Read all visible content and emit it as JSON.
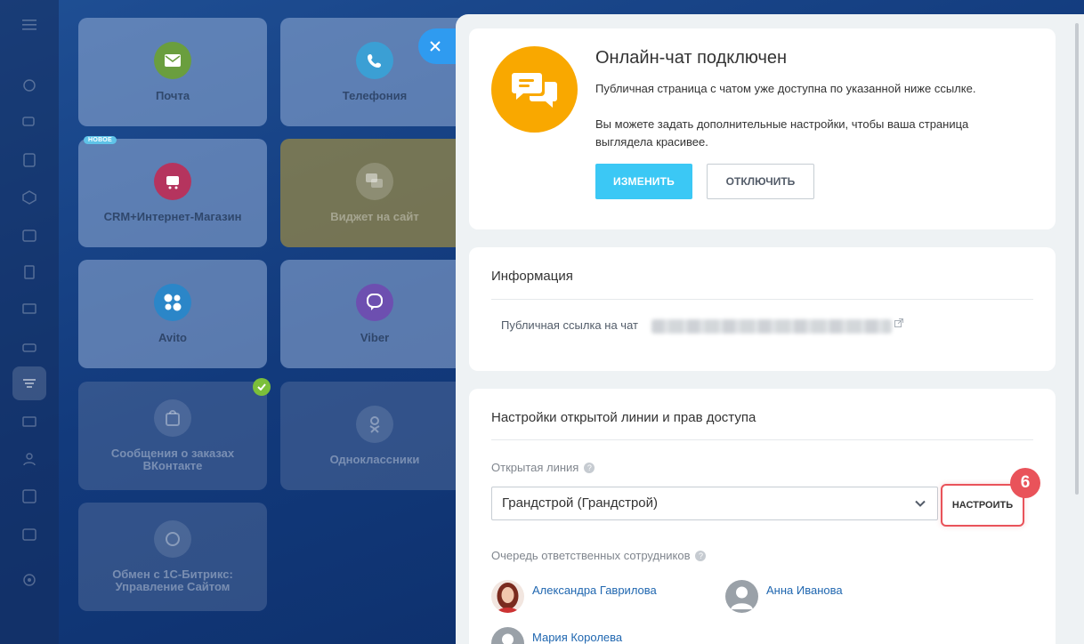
{
  "nav": {
    "icons": [
      "menu-icon",
      "feed-icon",
      "chat-icon",
      "tasks-icon",
      "crm-icon",
      "calendar-icon",
      "docs-icon",
      "sites-icon",
      "store-icon",
      "contact-center-icon",
      "mail-icon",
      "users-icon",
      "checklist-icon",
      "planner-icon",
      "settings-icon"
    ]
  },
  "tiles": [
    {
      "label": "Почта",
      "icon": "mail-icon"
    },
    {
      "label": "Телефония",
      "icon": "phone-icon"
    },
    {
      "label": "CRM+Интернет-Магазин",
      "icon": "store-icon",
      "badge": "НОВОЕ"
    },
    {
      "label": "Виджет на сайт",
      "icon": "chat-icon"
    },
    {
      "label": "Avito",
      "icon": "avito-icon"
    },
    {
      "label": "Viber",
      "icon": "viber-icon"
    },
    {
      "label": "Сообщения о заказах ВКонтакте",
      "icon": "vk-icon"
    },
    {
      "label": "Одноклассники",
      "icon": "ok-icon"
    },
    {
      "label": "Обмен с 1С-Битрикс: Управление Сайтом",
      "icon": "bitrix-icon"
    }
  ],
  "status_card": {
    "title": "Онлайн-чат подключен",
    "text1": "Публичная страница с чатом уже доступна по указанной ниже ссылке.",
    "text2": "Вы можете задать дополнительные настройки, чтобы ваша страница выглядела красивее.",
    "change_button": "ИЗМЕНИТЬ",
    "disable_button": "ОТКЛЮЧИТЬ"
  },
  "info_card": {
    "title": "Информация",
    "link_label": "Публичная ссылка на чат"
  },
  "settings_card": {
    "title": "Настройки открытой линии и прав доступа",
    "open_line_label": "Открытая линия",
    "open_line_value": "Грандстрой (Грандстрой)",
    "setup_button": "НАСТРОИТЬ",
    "step_number": "6",
    "queue_label": "Очередь ответственных сотрудников",
    "users": [
      {
        "name": "Александра Гаврилова"
      },
      {
        "name": "Анна Иванова"
      },
      {
        "name": "Мария Королева"
      }
    ]
  },
  "colors": {
    "accent": "#3bc8f5",
    "chat_badge": "#f9a800",
    "highlight": "#e9535a",
    "link": "#2067b0"
  }
}
